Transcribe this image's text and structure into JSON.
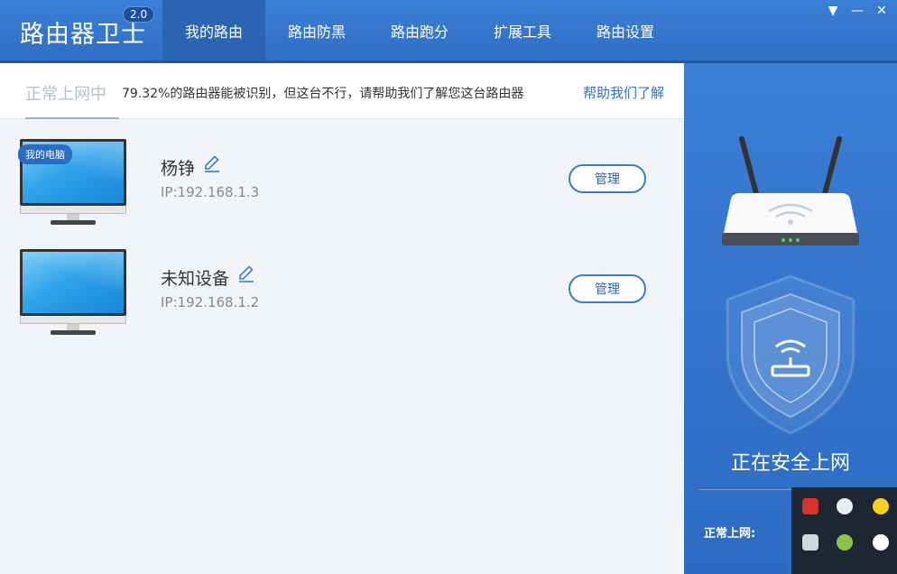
{
  "header": {
    "logo": "路由器卫士",
    "version": "2.0",
    "tabs": [
      {
        "label": "我的路由",
        "active": true
      },
      {
        "label": "路由防黑",
        "active": false
      },
      {
        "label": "路由跑分",
        "active": false
      },
      {
        "label": "扩展工具",
        "active": false
      },
      {
        "label": "路由设置",
        "active": false
      }
    ],
    "window_controls": {
      "menu": "▼",
      "minimize": "—",
      "close": "✕"
    }
  },
  "notice": {
    "status": "正常上网中",
    "message": "79.32%的路由器能被识别，但这台不行，请帮助我们了解您这台路由器",
    "help_link": "帮助我们了解"
  },
  "devices": [
    {
      "badge": "我的电脑",
      "name": "杨铮",
      "ip": "IP:192.168.1.3",
      "action": "管理"
    },
    {
      "badge": "",
      "name": "未知设备",
      "ip": "IP:192.168.1.2",
      "action": "管理"
    }
  ],
  "side": {
    "safe_text": "正在安全上网",
    "online_label": "正常上网:"
  },
  "colors": {
    "primary": "#3b7fd6",
    "active_tab": "#2a64b2",
    "link": "#2f72c4",
    "status_muted": "#b8c0cc"
  }
}
